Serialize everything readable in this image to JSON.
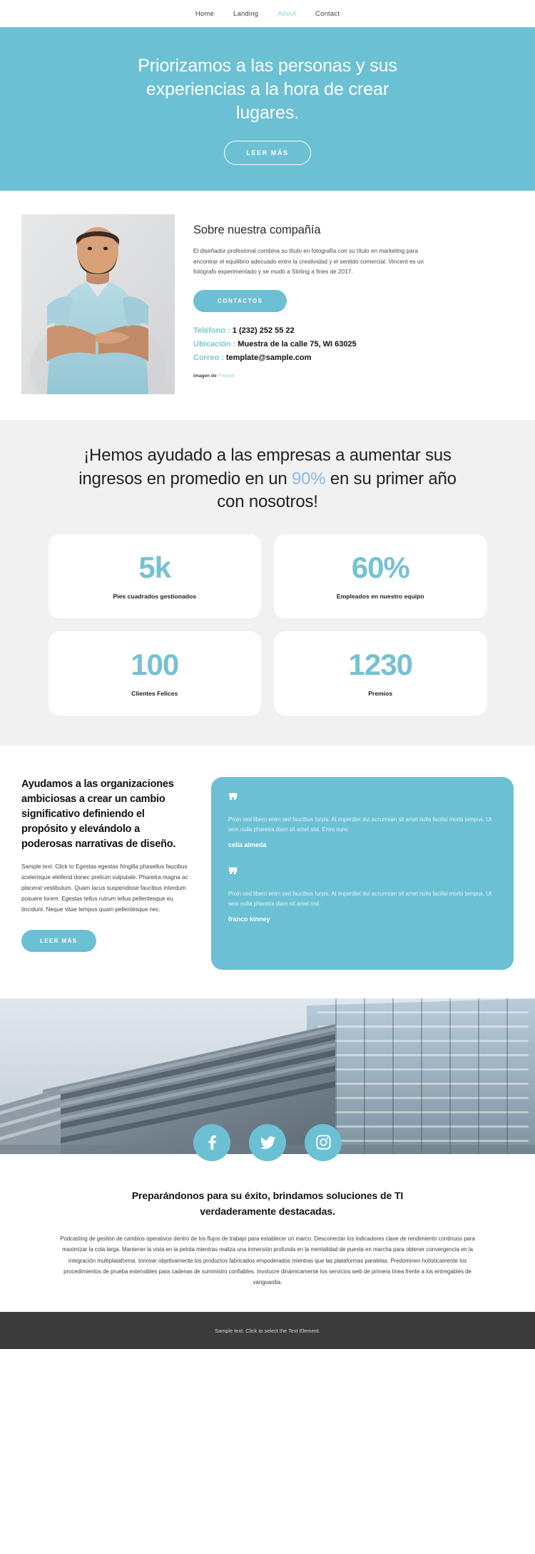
{
  "nav": {
    "items": [
      {
        "label": "Home",
        "active": false
      },
      {
        "label": "Landing",
        "active": false
      },
      {
        "label": "About",
        "active": true
      },
      {
        "label": "Contact",
        "active": false
      }
    ]
  },
  "hero": {
    "headline": "Priorizamos a las personas y sus experiencias a la hora de crear lugares.",
    "button": "LEER MÁS",
    "bg_color": "#6cc0d4"
  },
  "about": {
    "title": "Sobre nuestra compañía",
    "paragraph": "El diseñador profesional combina su título en fotografía con su título en marketing para encontrar el equilibrio adecuado entre la creatividad y el sentido comercial. Vincent es un fotógrafo experimentado y se mudó a Stirling a fines de 2017.",
    "button": "CONTACTOS",
    "contacts": [
      {
        "label": "Teléfono",
        "sep": " : ",
        "value": "1 (232) 252 55 22"
      },
      {
        "label": "Ubicación",
        "sep": " : ",
        "value": "Muestra de la calle 75, WI 63025"
      },
      {
        "label": "Correo",
        "sep": " : ",
        "value": "template@sample.com"
      }
    ],
    "credit_prefix": "Imagen de",
    "credit_link": "Freepik"
  },
  "stats": {
    "heading_part1": "¡Hemos ayudado a las empresas a aumentar sus ingresos en promedio en un ",
    "heading_highlight": "90%",
    "heading_part2": " en su primer año con nosotros!",
    "highlight_color": "#8fb8e8",
    "cards": [
      {
        "number": "5k",
        "caption": "Pies cuadrados gestionados"
      },
      {
        "number": "60%",
        "caption": "Empleados en nuestro equipo"
      },
      {
        "number": "100",
        "caption": "Clientes Felices"
      },
      {
        "number": "1230",
        "caption": "Premios"
      }
    ]
  },
  "narrative": {
    "title": "Ayudamos a las organizaciones ambiciosas a crear un cambio significativo definiendo el propósito y elevándolo a poderosas narrativas de diseño.",
    "paragraph": "Sample text. Click to Egestas egestas fringilla phasellus faucibus scelerisque eleifend donec pretium vulputate. Pharetra magna ac placerat vestibulum. Quam lacus suspendisse faucibus interdum posuere lorem. Egestas tellus rutrum tellus pellentesque eu tincidunt. Neque vitae tempus quam pellentesque nec.",
    "button": "LEER MÁS"
  },
  "testimonials": {
    "quote_glyph": "❞",
    "items": [
      {
        "text": "Proin sed libero enim sed faucibus turpis. At imperdiet dui accumsan sit amet nulla facilisi morbi tempus. Ut sem nulla pharetra diam sit amet nisl. Enim nunc",
        "author": "celia almeda"
      },
      {
        "text": "Proin sed libero enim sed faucibus turpis. At imperdiet dui accumsan sit amet nulla facilisi morbi tempus. Ut sem nulla pharetra diam sit amet nisl.",
        "author": "franco kinney"
      }
    ]
  },
  "social": {
    "items": [
      {
        "name": "facebook-icon"
      },
      {
        "name": "twitter-icon"
      },
      {
        "name": "instagram-icon"
      }
    ]
  },
  "closing": {
    "heading": "Preparándonos para su éxito, brindamos soluciones de TI verdaderamente destacadas.",
    "paragraph": "Podcasting de gestión de cambios operativos dentro de los flujos de trabajo para establecer un marco. Desconectar los indicadores clave de rendimiento continuos para maximizar la cola larga. Mantener la vista en la pelota mientras realiza una inmersión profunda en la mentalidad de puesta en marcha para obtener convergencia en la integración multiplataforma. Innovar objetivamente los productos fabricados empoderados mientras que las plataformas paralelas. Predominen holísticamente los procedimientos de prueba extensibles para cadenas de suministro confiables. Involucre dinámicamente los servicios web de primera línea frente a los entregables de vanguardia."
  },
  "footer": {
    "text": "Sample text. Click to select the Text Element."
  }
}
